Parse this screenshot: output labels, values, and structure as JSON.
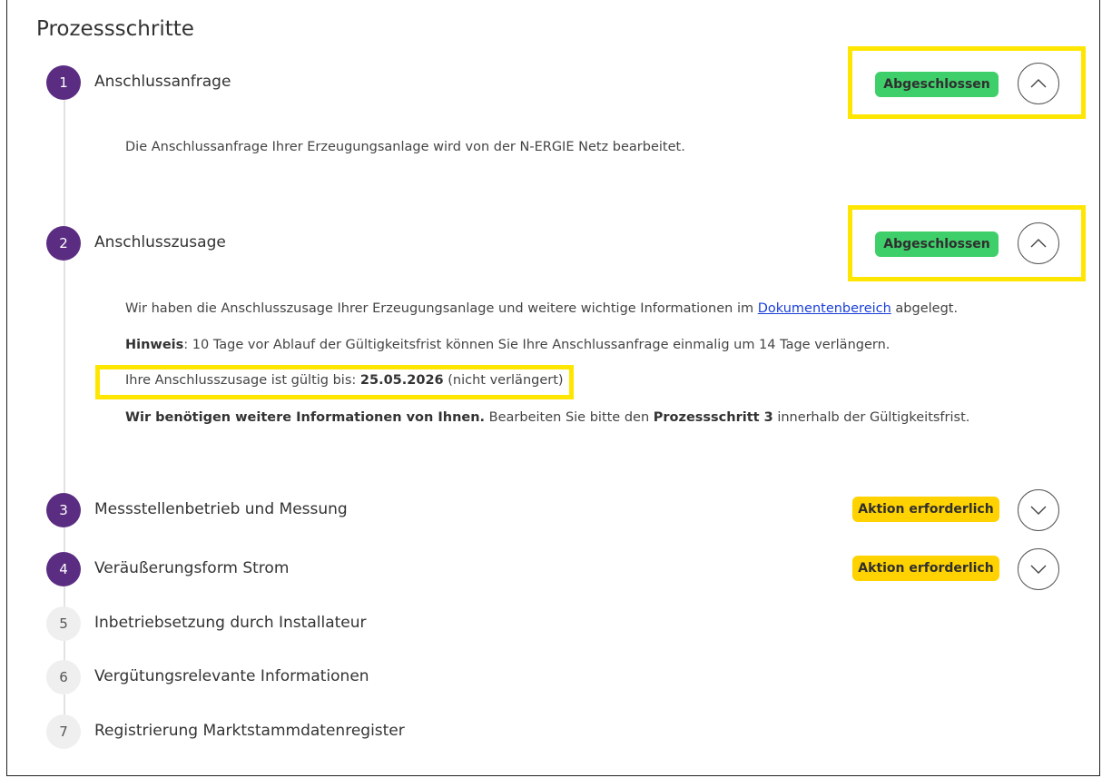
{
  "title": "Prozessschritte",
  "steps": [
    {
      "number": "1",
      "label": "Anschlussanfrage",
      "status": "Abgeschlossen",
      "expanded": true,
      "text": "Die Anschlussanfrage Ihrer Erzeugungsanlage wird von der N-ERGIE Netz bearbeitet."
    },
    {
      "number": "2",
      "label": "Anschlusszusage",
      "status": "Abgeschlossen",
      "expanded": true,
      "line1_before": "Wir haben die Anschlusszusage Ihrer Erzeugungsanlage und weitere wichtige Informationen im ",
      "line1_link": "Dokumentenbereich",
      "line1_after": " abgelegt.",
      "hint_label": "Hinweis",
      "hint_text": ": 10 Tage vor Ablauf der Gültigkeitsfrist können Sie Ihre Anschlussanfrage einmalig um 14 Tage verlängern.",
      "valid_before": "Ihre Anschlusszusage ist gültig bis: ",
      "valid_date": "25.05.2026",
      "valid_after": " (nicht verlängert)",
      "info_bold": "Wir benötigen weitere Informationen von Ihnen.",
      "info_mid": " Bearbeiten Sie bitte den ",
      "info_bold2": "Prozessschritt 3",
      "info_after": " innerhalb der Gültigkeitsfrist."
    },
    {
      "number": "3",
      "label": "Messstellenbetrieb und Messung",
      "status": "Aktion erforderlich",
      "expanded": false
    },
    {
      "number": "4",
      "label": "Veräußerungsform Strom",
      "status": "Aktion erforderlich",
      "expanded": false
    },
    {
      "number": "5",
      "label": "Inbetriebsetzung durch Installateur"
    },
    {
      "number": "6",
      "label": "Vergütungsrelevante Informationen"
    },
    {
      "number": "7",
      "label": "Registrierung Marktstammdatenregister"
    }
  ],
  "colors": {
    "active": "#5b2d82",
    "done": "#3fcf6a",
    "action": "#ffd200",
    "highlight": "#ffe600"
  }
}
